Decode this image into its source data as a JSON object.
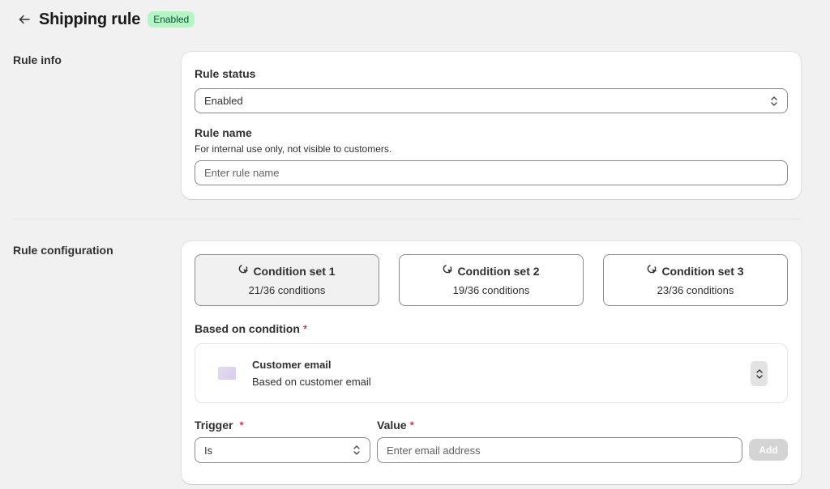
{
  "header": {
    "title": "Shipping rule",
    "status_badge": "Enabled"
  },
  "rule_info": {
    "section_label": "Rule info",
    "status_label": "Rule status",
    "status_value": "Enabled",
    "name_label": "Rule name",
    "name_helper": "For internal use only, not visible to customers.",
    "name_placeholder": "Enter rule name"
  },
  "rule_config": {
    "section_label": "Rule configuration",
    "condition_sets": [
      {
        "title": "Condition set 1",
        "count": "21/36 conditions"
      },
      {
        "title": "Condition set 2",
        "count": "19/36 conditions"
      },
      {
        "title": "Condition set 3",
        "count": "23/36 conditions"
      }
    ],
    "based_on_label": "Based on condition",
    "required_mark": "*",
    "condition": {
      "title": "Customer email",
      "subtitle": "Based on customer email"
    },
    "trigger_label": "Trigger",
    "trigger_value": "Is",
    "value_label": "Value",
    "value_placeholder": "Enter email address",
    "add_label": "Add"
  },
  "colors": {
    "badge_bg": "#b4f5c5",
    "badge_text": "#0c5132",
    "required": "#c70a24"
  }
}
